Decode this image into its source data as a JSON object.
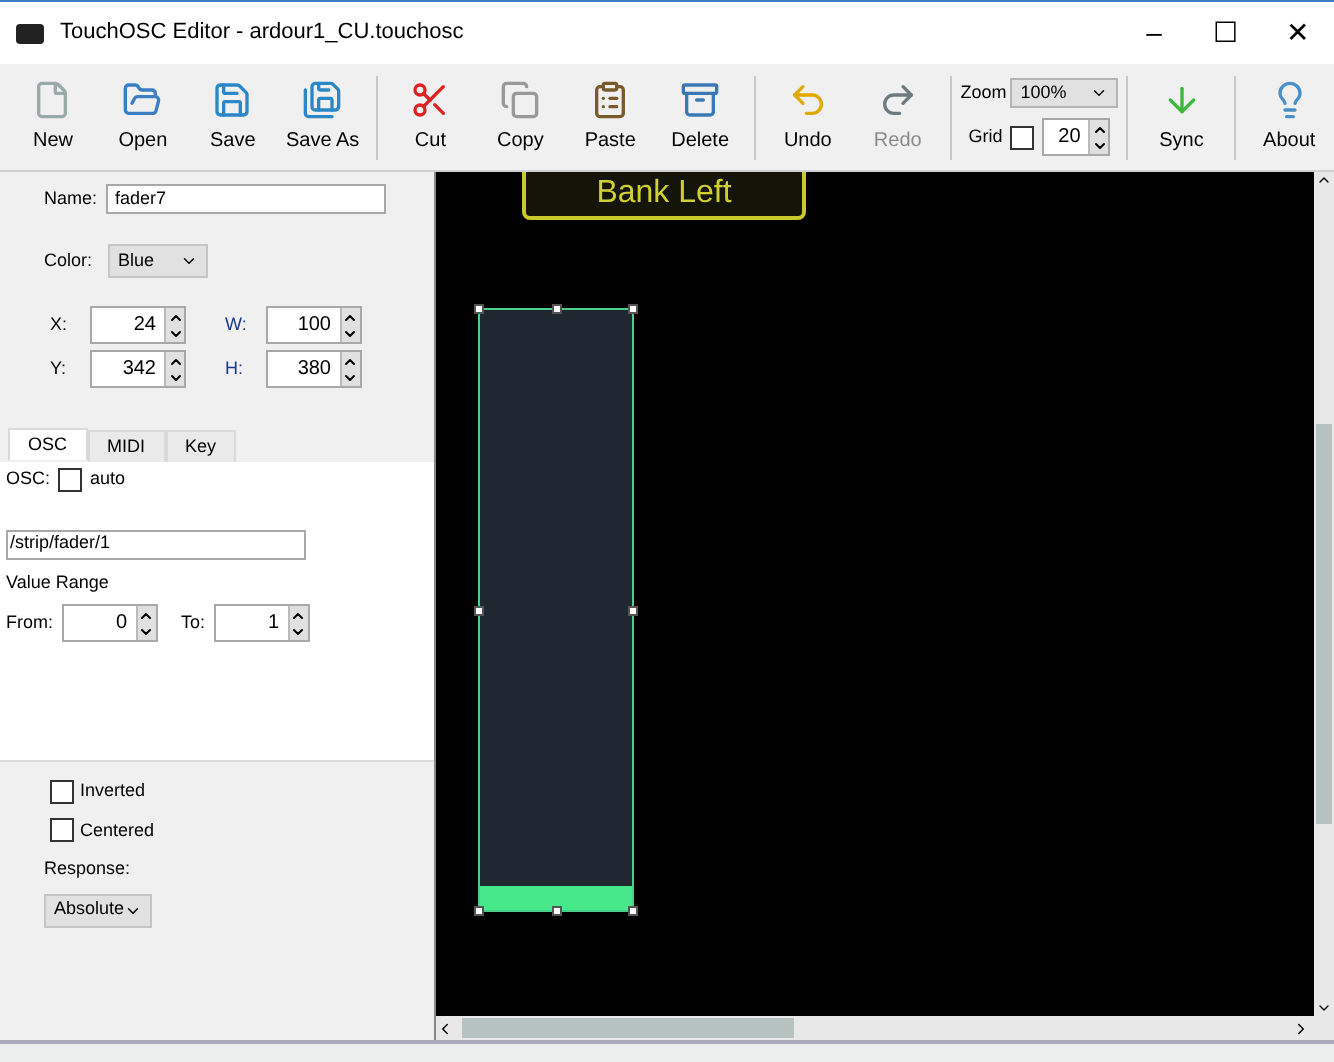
{
  "window": {
    "title": "TouchOSC Editor - ardour1_CU.touchosc",
    "controls": [
      "–",
      "☐",
      "✕"
    ]
  },
  "toolbar": {
    "groups": [
      [
        {
          "label": "New",
          "disabled": false
        },
        {
          "label": "Open",
          "disabled": false
        },
        {
          "label": "Save",
          "disabled": false
        },
        {
          "label": "Save As",
          "disabled": false
        }
      ],
      [
        {
          "label": "Cut",
          "disabled": false
        },
        {
          "label": "Copy",
          "disabled": false
        },
        {
          "label": "Paste",
          "disabled": false
        },
        {
          "label": "Delete",
          "disabled": false
        }
      ],
      [
        {
          "label": "Undo",
          "disabled": false
        },
        {
          "label": "Redo",
          "disabled": true
        }
      ]
    ],
    "zoom": {
      "label": "Zoom",
      "value": "100%"
    },
    "grid": {
      "label": "Grid",
      "checked": false,
      "value": "20"
    },
    "end_buttons": [
      {
        "label": "Sync",
        "disabled": false
      },
      {
        "label": "About",
        "disabled": false
      }
    ]
  },
  "properties": {
    "name": {
      "label": "Name:",
      "value": "fader7"
    },
    "color": {
      "label": "Color:",
      "value": "Blue"
    },
    "geometry": [
      {
        "label": "X:",
        "value": "24"
      },
      {
        "label": "W:",
        "value": "100"
      },
      {
        "label": "Y:",
        "value": "342"
      },
      {
        "label": "H:",
        "value": "380"
      }
    ],
    "tabs": [
      {
        "label": "OSC",
        "selected": true
      },
      {
        "label": "MIDI",
        "selected": false
      },
      {
        "label": "Key",
        "selected": false
      }
    ],
    "osc": {
      "label": "OSC:",
      "auto_label": "auto",
      "auto_checked": false,
      "address": "/strip/fader/1",
      "range_label": "Value Range",
      "from_label": "From:",
      "from": "0",
      "to_label": "To:",
      "to": "1"
    },
    "options": [
      {
        "label": "Inverted",
        "checked": false
      },
      {
        "label": "Centered",
        "checked": false
      }
    ],
    "response": {
      "label": "Response:",
      "value": "Absolute"
    }
  },
  "canvas": {
    "button": {
      "label": "Bank Left"
    },
    "fader": {
      "selected": true,
      "level": 0.04
    }
  }
}
